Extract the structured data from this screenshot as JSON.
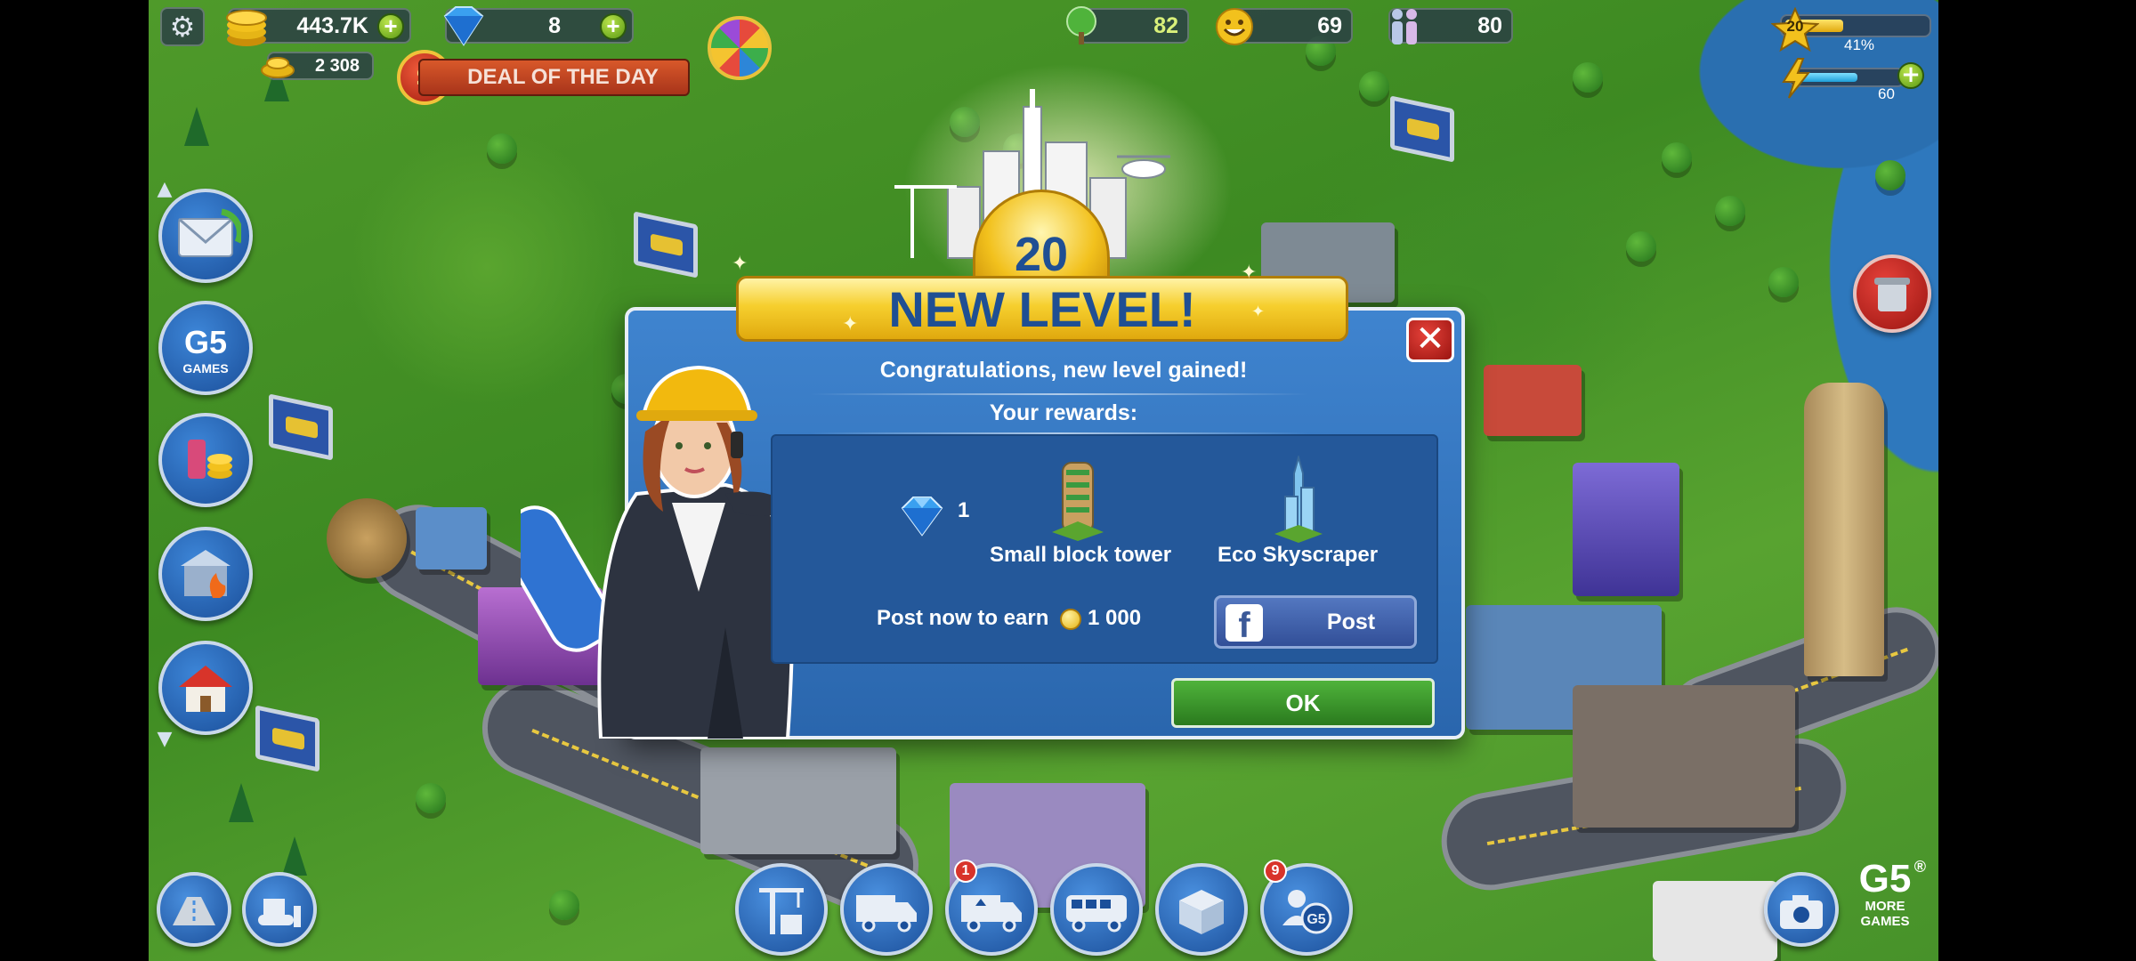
{
  "hud": {
    "coins": "443.7K",
    "gems": "8",
    "small_coins": "2 308",
    "deal_label": "DEAL OF THE DAY",
    "deal_symbol": "$",
    "trees": "82",
    "happiness": "69",
    "population": "80",
    "player_level": "20",
    "xp_percent": "41%",
    "xp_fraction": 0.41,
    "energy": "60",
    "energy_fraction": 0.6,
    "plus": "+"
  },
  "side": {
    "g5_label": "G5",
    "g5_sub": "GAMES"
  },
  "toolbar": {
    "recycle_badge": "1",
    "friends_badge": "9"
  },
  "modal": {
    "level_number": "20",
    "title": "NEW LEVEL!",
    "congrats": "Congratulations, new level gained!",
    "rewards_label": "Your rewards:",
    "gem_count": "1",
    "reward_1": "Small block tower",
    "reward_2": "Eco Skyscraper",
    "post_text": "Post now to earn",
    "post_amount": "1 000",
    "post_button": "Post",
    "fb_letter": "f",
    "ok_button": "OK",
    "close_symbol": "✕"
  },
  "brand": {
    "g5": "G5",
    "registered": "®",
    "more_games": "MORE GAMES"
  },
  "colors": {
    "accent_blue": "#2a66ad",
    "title_gold": "#f6cf2e",
    "ok_green": "#2a7a1e",
    "close_red": "#d8342a"
  }
}
